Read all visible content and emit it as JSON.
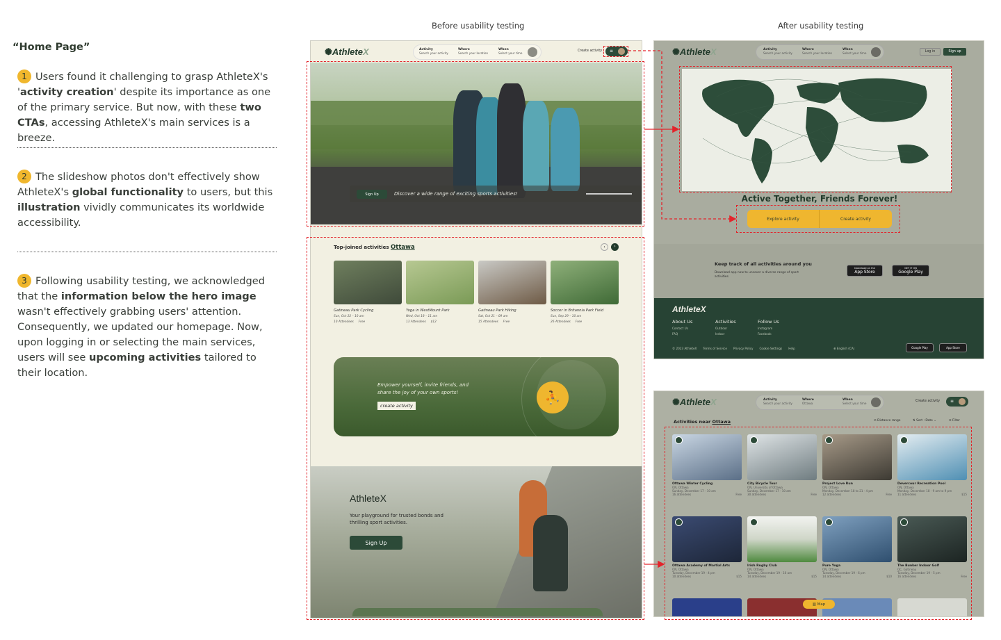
{
  "notes": {
    "title": "“Home Page”",
    "items": [
      {
        "num": "1",
        "parts": [
          "Users found it challenging to grasp AthleteX's '",
          "activity creation",
          "' despite its importance as one of the primary service. But now, with these ",
          "two CTAs",
          ", accessing AthleteX's main services is a breeze."
        ]
      },
      {
        "num": "2",
        "parts": [
          "The slideshow photos don't effectively show AthleteX's ",
          "global functionality",
          " to users, but this ",
          "illustration",
          " vividly communicates its worldwide accessibility."
        ]
      },
      {
        "num": "3",
        "parts": [
          "Following usability testing, we acknowledged that the ",
          "information below the hero image",
          " wasn't effectively grabbing users' attention. Consequently, we updated our homepage. Now, upon logging in or selecting the main services, users will see ",
          "upcoming activities",
          " tailored to their location."
        ]
      }
    ]
  },
  "captions": {
    "before": "Before usability testing",
    "after": "After usability testing"
  },
  "nav": {
    "logo_main": "Athlete",
    "logo_x": "X",
    "activity": "Activity",
    "activity_sub": "Search your activity",
    "where": "Where",
    "where_sub": "Search your location",
    "when": "When",
    "when_sub": "Select your time",
    "create": "Create activity",
    "login": "Log in",
    "signup": "Sign up"
  },
  "before": {
    "hero_signup": "Sign Up",
    "hero_tagline": "Discover a wide range of exciting sports activities!",
    "top_joined": "Top-joined activities",
    "city": "Ottawa",
    "cards": [
      {
        "title": "Gatineau Park Cycling",
        "date": "Sun, Oct 22 – 10 am",
        "att": "10 Attendees",
        "price": "Free",
        "color": "#7d8a6a"
      },
      {
        "title": "Yoga in WestMount Park",
        "date": "Wed, Oct 18 – 11 am",
        "att": "13 Attendees",
        "price": "$12",
        "color": "#9fb37c"
      },
      {
        "title": "Gatineau Park Hiking",
        "date": "Sat, Oct 21 – 09 am",
        "att": "15 Attendees",
        "price": "Free",
        "color": "#8a7560"
      },
      {
        "title": "Soccer in Britannia Park Field",
        "date": "Sun, Sep 29 – 10 am",
        "att": "26 Attendees",
        "price": "Free",
        "color": "#5f8a4f"
      }
    ],
    "banner_text": "Empower yourself, invite friends, and share the joy of your own sports!",
    "banner_btn": "create activity",
    "bottom_title": "AthleteX",
    "bottom_text": "Your playground for trusted bonds and thrilling sport activities.",
    "bottom_btn": "Sign Up"
  },
  "after": {
    "slogan": "Active Together, Friends Forever!",
    "explore": "Explore activity",
    "create": "Create activity",
    "keep_title": "Keep track of all activities around you",
    "keep_text": "Download app now to uncover a diverse range of sport activities.",
    "app_store_small": "Download on the",
    "app_store": "App Store",
    "google_small": "GET IT ON",
    "google": "Google Play",
    "footer_logo": "AthleteX",
    "about": "About Us",
    "about_1": "Contact Us",
    "about_2": "FAQ",
    "activities": "Activities",
    "act_1": "Outdoor",
    "act_2": "Indoor",
    "follow": "Follow Us",
    "fol_1": "Instagram",
    "fol_2": "Facebook",
    "legal": [
      "© 2023 AthleteX",
      "Terms of Service",
      "Privacy Policy",
      "Cookie Settings",
      "Help"
    ],
    "lang": "English (CA)"
  },
  "after2": {
    "where_value": "Ottawa",
    "near": "Activities near",
    "city": "Ottawa",
    "distance": "Distance range",
    "sort": "Sort : Date",
    "filter": "Filter",
    "map": "Map",
    "cards": [
      {
        "title": "Ottawa Winter Cycling",
        "loc": "ON, Ottawa",
        "date": "Sunday, December 17 - 10 am",
        "att": "16 attendees",
        "price": "Free",
        "color": "#7b8fa8"
      },
      {
        "title": "City Bicycle Tour",
        "loc": "ON, University of Ottawa",
        "date": "Sunday, December 17 - 10 am",
        "att": "30 attendees",
        "price": "Free",
        "color": "#8e9a9e"
      },
      {
        "title": "Project Love Run",
        "loc": "ON, Ottawa",
        "date": "Monday, December 18 to 21 - 4 pm",
        "att": "12 attendees",
        "price": "Free",
        "color": "#6c6a62"
      },
      {
        "title": "Devercour Recreation Pool",
        "loc": "ON, Ottawa",
        "date": "Monday, December 18 - 9 am to 9 pm",
        "att": "11 attendees",
        "price": "$15",
        "color": "#8ab2c9"
      },
      {
        "title": "Ottawa Academy of Martial Arts",
        "loc": "ON, Ottawa",
        "date": "Tuesday, December 19 - 4 pm",
        "att": "10 attendees",
        "price": "$15",
        "color": "#2e3e5e"
      },
      {
        "title": "Irish Rugby Club",
        "loc": "ON, Ottawa",
        "date": "Tuesday, December 19 - 10 am",
        "att": "14 attendees",
        "price": "$15",
        "color": "#6f8f5f"
      },
      {
        "title": "Pure Yoga",
        "loc": "ON, Ottawa",
        "date": "Tuesday, December 19 - 6 pm",
        "att": "14 attendees",
        "price": "$10",
        "color": "#4f6f8f"
      },
      {
        "title": "The Bunker Indoor Golf",
        "loc": "QC, Gatineau",
        "date": "Tuesday, December 19 - 5 pm",
        "att": "16 attendees",
        "price": "Free",
        "color": "#3c4a45"
      }
    ]
  }
}
